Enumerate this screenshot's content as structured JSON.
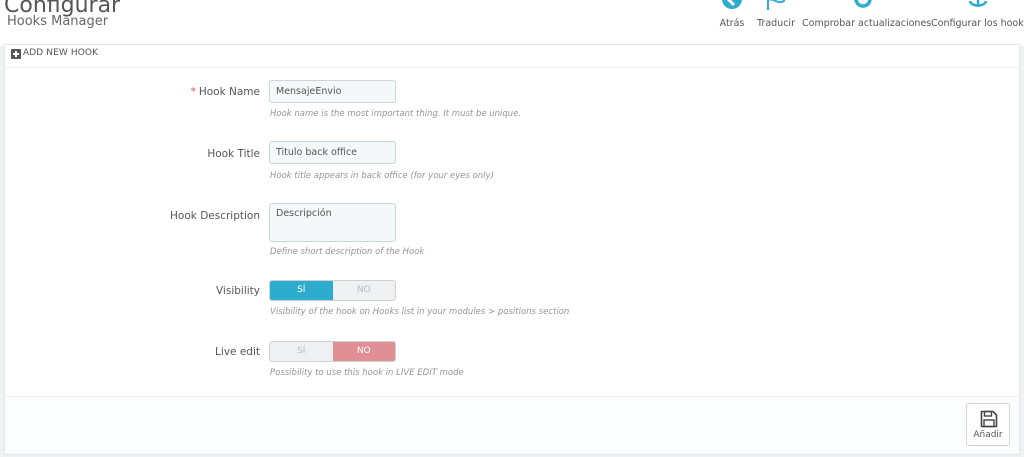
{
  "header": {
    "title": "Configurar",
    "subtitle": "Hooks Manager"
  },
  "toolbar": {
    "back_label": "Atrás",
    "translate_label": "Traducir",
    "check_updates_label": "Comprobar actualizaciones",
    "configure_hooks_label": "Configurar los hooks",
    "accent_color": "#2eacce"
  },
  "panel": {
    "heading": "ADD NEW HOOK"
  },
  "form": {
    "hook_name": {
      "label": "Hook Name",
      "required_mark": "*",
      "value": "MensajeEnvio",
      "help": "Hook name is the most important thing. It must be unique."
    },
    "hook_title": {
      "label": "Hook Title",
      "value": "Titulo back office",
      "help": "Hook title appears in back office (for your eyes only)"
    },
    "hook_description": {
      "label": "Hook Description",
      "value": "Descripción",
      "help": "Define short description of the Hook"
    },
    "visibility": {
      "label": "Visibility",
      "yes_label": "SÍ",
      "no_label": "NO",
      "selected": "yes",
      "help": "Visibility of the hook on Hooks list in your modules > positions section"
    },
    "live_edit": {
      "label": "Live edit",
      "yes_label": "SÍ",
      "no_label": "NO",
      "selected": "no",
      "help": "Possibility to use this hook in LIVE EDIT mode"
    }
  },
  "footer": {
    "save_label": "Añadir"
  }
}
